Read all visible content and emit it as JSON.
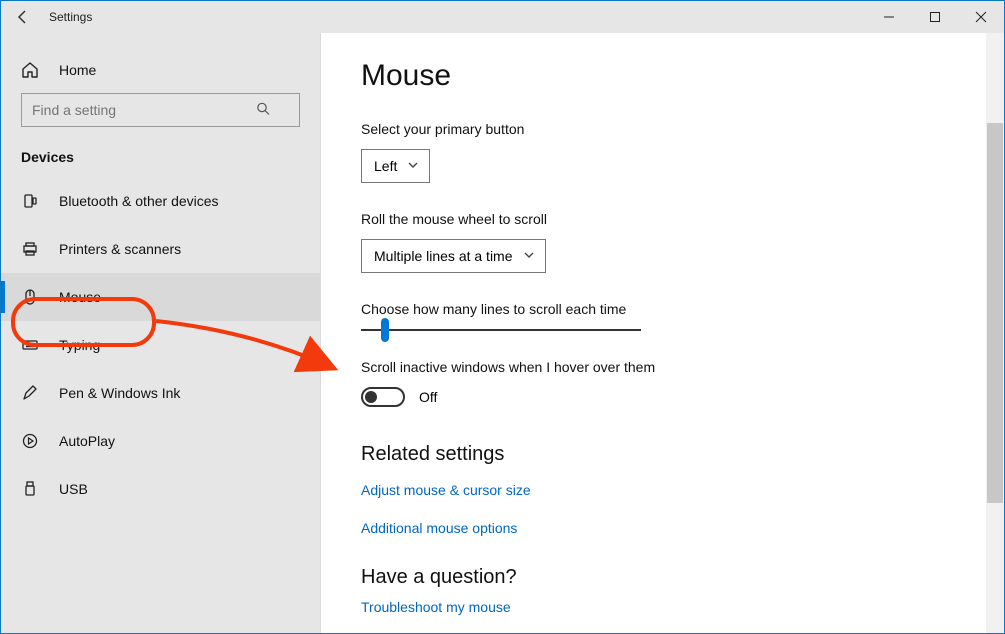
{
  "titlebar": {
    "title": "Settings"
  },
  "sidebar": {
    "home": "Home",
    "search_placeholder": "Find a setting",
    "section": "Devices",
    "items": [
      {
        "label": "Bluetooth & other devices"
      },
      {
        "label": "Printers & scanners"
      },
      {
        "label": "Mouse"
      },
      {
        "label": "Typing"
      },
      {
        "label": "Pen & Windows Ink"
      },
      {
        "label": "AutoPlay"
      },
      {
        "label": "USB"
      }
    ]
  },
  "page": {
    "title": "Mouse",
    "primary_label": "Select your primary button",
    "primary_value": "Left",
    "wheel_label": "Roll the mouse wheel to scroll",
    "wheel_value": "Multiple lines at a time",
    "lines_label": "Choose how many lines to scroll each time",
    "inactive_label": "Scroll inactive windows when I hover over them",
    "inactive_state": "Off",
    "related_h": "Related settings",
    "link_adjust": "Adjust mouse & cursor size",
    "link_additional": "Additional mouse options",
    "question_h": "Have a question?",
    "link_trouble": "Troubleshoot my mouse"
  }
}
